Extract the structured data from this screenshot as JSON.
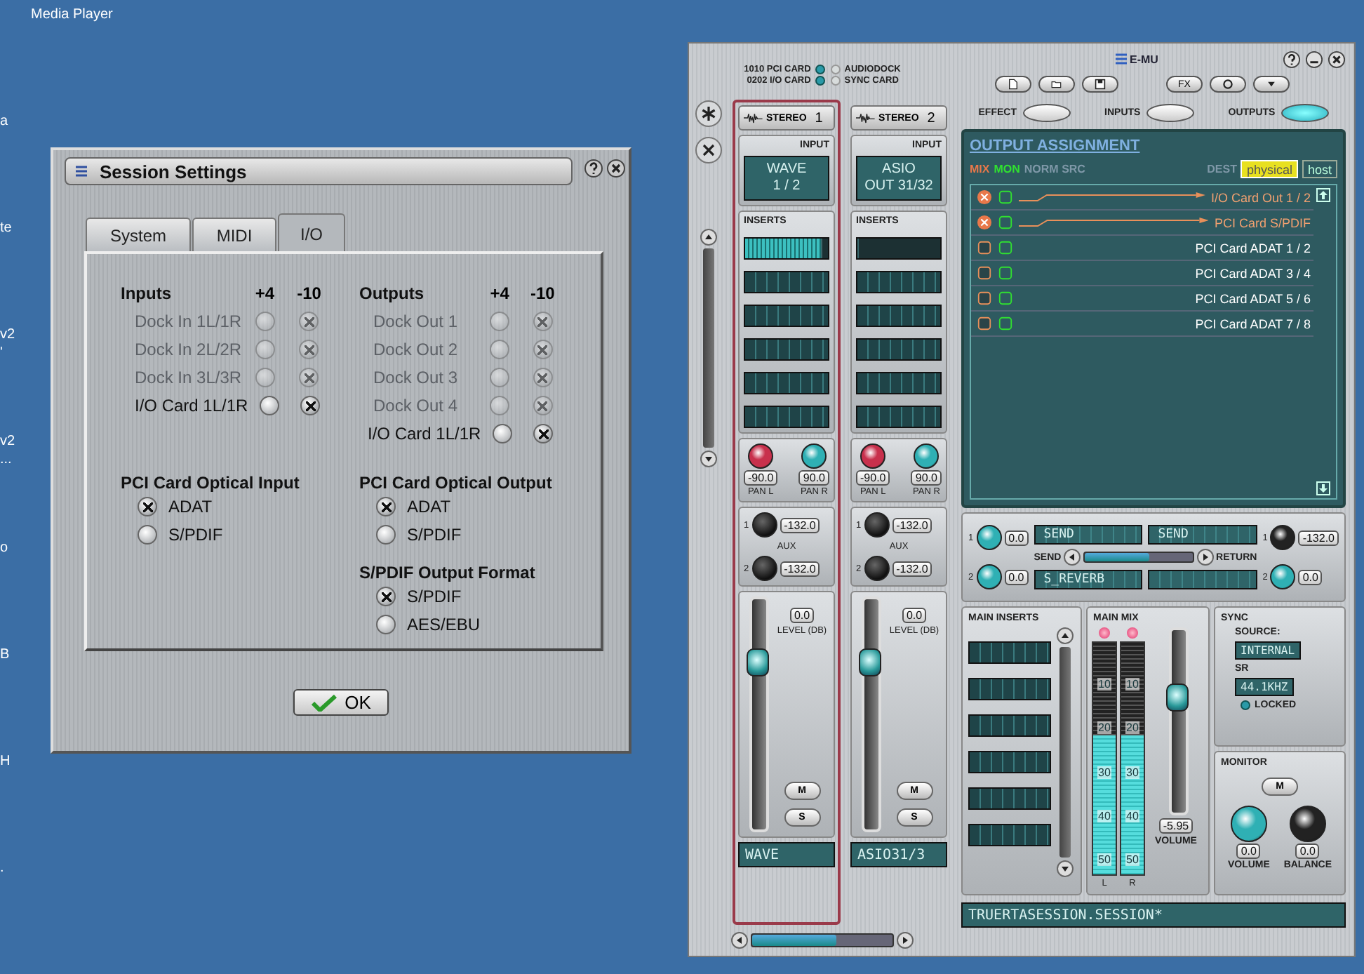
{
  "desktop_icons": [
    {
      "lines": [
        "Media Player"
      ]
    },
    {
      "lines": [
        "a"
      ]
    },
    {
      "lines": [
        "te"
      ]
    },
    {
      "lines": [
        "v2",
        "'"
      ]
    },
    {
      "lines": [
        "v2",
        "..."
      ]
    },
    {
      "lines": [
        "o"
      ]
    },
    {
      "lines": [
        "B"
      ]
    },
    {
      "lines": [
        "H"
      ]
    },
    {
      "lines": [
        "."
      ]
    }
  ],
  "session_dialog": {
    "title": "Session Settings",
    "tabs": [
      {
        "label": "System",
        "selected": false
      },
      {
        "label": "MIDI",
        "selected": false
      },
      {
        "label": "I/O",
        "selected": true
      }
    ],
    "level_sections": [
      {
        "heading": "Inputs",
        "columns": [
          "+4",
          "-10"
        ],
        "rows": [
          {
            "label": "Dock In 1L/1R",
            "disabled": true,
            "radios": [
              {
                "selected": false
              },
              {
                "selected": true
              }
            ]
          },
          {
            "label": "Dock In 2L/2R",
            "disabled": true,
            "radios": [
              {
                "selected": false
              },
              {
                "selected": true
              }
            ]
          },
          {
            "label": "Dock In 3L/3R",
            "disabled": true,
            "radios": [
              {
                "selected": false
              },
              {
                "selected": true
              }
            ]
          },
          {
            "label": "I/O Card 1L/1R",
            "disabled": false,
            "radios": [
              {
                "selected": false
              },
              {
                "selected": true
              }
            ]
          }
        ]
      },
      {
        "heading": "Outputs",
        "columns": [
          "+4",
          "-10"
        ],
        "rows": [
          {
            "label": "Dock Out 1",
            "disabled": true,
            "radios": [
              {
                "selected": false
              },
              {
                "selected": true
              }
            ]
          },
          {
            "label": "Dock Out 2",
            "disabled": true,
            "radios": [
              {
                "selected": false
              },
              {
                "selected": true
              }
            ]
          },
          {
            "label": "Dock Out 3",
            "disabled": true,
            "radios": [
              {
                "selected": false
              },
              {
                "selected": true
              }
            ]
          },
          {
            "label": "Dock Out 4",
            "disabled": true,
            "radios": [
              {
                "selected": false
              },
              {
                "selected": true
              }
            ]
          },
          {
            "label": "I/O Card 1L/1R",
            "disabled": false,
            "radios": [
              {
                "selected": false
              },
              {
                "selected": true
              }
            ]
          }
        ]
      }
    ],
    "option_columns": [
      [
        {
          "heading": "PCI Card Optical Input",
          "options": [
            {
              "label": "ADAT",
              "selected": true
            },
            {
              "label": "S/PDIF",
              "selected": false
            }
          ]
        }
      ],
      [
        {
          "heading": "PCI Card Optical Output",
          "options": [
            {
              "label": "ADAT",
              "selected": true
            },
            {
              "label": "S/PDIF",
              "selected": false
            }
          ]
        },
        {
          "heading": "S/PDIF Output Format",
          "options": [
            {
              "label": "S/PDIF",
              "selected": true
            },
            {
              "label": "AES/EBU",
              "selected": false
            }
          ]
        }
      ]
    ],
    "ok_button": "OK"
  },
  "mixer": {
    "hardware": [
      {
        "label": "1010 PCI CARD",
        "on": true
      },
      {
        "label": "0202 I/O CARD",
        "on": true
      },
      {
        "label": "AUDIODOCK",
        "on": false
      },
      {
        "label": "SYNC CARD",
        "on": false
      }
    ],
    "logo": "E-MU",
    "fx_button": "FX",
    "views": [
      {
        "label": "EFFECT",
        "selected": false
      },
      {
        "label": "INPUTS",
        "selected": false
      },
      {
        "label": "OUTPUTS",
        "selected": true
      }
    ],
    "strips": [
      {
        "name": "STEREO",
        "number": "1",
        "selected": true,
        "input_label": "INPUT",
        "input_lines": [
          "WAVE",
          "1 / 2"
        ],
        "inserts_label": "INSERTS",
        "meter": {
          "level": 0.92
        },
        "pans": [
          {
            "value": "-90.0",
            "label": "PAN L",
            "color": "#c8304c"
          },
          {
            "value": "90.0",
            "label": "PAN R",
            "color": "#2fb0b4"
          }
        ],
        "aux_label": "AUX",
        "aux": [
          {
            "index": "1",
            "value": "-132.0"
          },
          {
            "index": "2",
            "value": "-132.0"
          }
        ],
        "level_value": "0.0",
        "level_label": "LEVEL (DB)",
        "fader": {
          "level": 0.72
        },
        "mute": "M",
        "solo": "S",
        "display": "WAVE"
      },
      {
        "name": "STEREO",
        "number": "2",
        "selected": false,
        "input_label": "INPUT",
        "input_lines": [
          "ASIO",
          "OUT 31/32"
        ],
        "inserts_label": "INSERTS",
        "meter": {
          "level": 0
        },
        "pans": [
          {
            "value": "-90.0",
            "label": "PAN L",
            "color": "#c8304c"
          },
          {
            "value": "90.0",
            "label": "PAN R",
            "color": "#2fb0b4"
          }
        ],
        "aux_label": "AUX",
        "aux": [
          {
            "index": "1",
            "value": "-132.0"
          },
          {
            "index": "2",
            "value": "-132.0"
          }
        ],
        "level_value": "0.0",
        "level_label": "LEVEL (DB)",
        "fader": {
          "level": 0.72
        },
        "mute": "M",
        "solo": "S",
        "display": "ASIO31/3"
      }
    ],
    "output_assignment": {
      "title": "OUTPUT ASSIGNMENT",
      "mix_label": "MIX",
      "mon_label": "MON",
      "norm_label": "NORM SRC",
      "dest_label": "DEST",
      "dest_tabs": [
        {
          "label": "physical",
          "selected": true
        },
        {
          "label": "host",
          "selected": false
        }
      ],
      "rows": [
        {
          "label": "I/O Card Out 1 / 2",
          "mix": true,
          "mon": false
        },
        {
          "label": "PCI Card S/PDIF",
          "mix": true,
          "mon": false
        },
        {
          "label": "PCI Card ADAT 1 / 2",
          "mix": false,
          "mon": false
        },
        {
          "label": "PCI Card ADAT 3 / 4",
          "mix": false,
          "mon": false
        },
        {
          "label": "PCI Card ADAT 5 / 6",
          "mix": false,
          "mon": false
        },
        {
          "label": "PCI Card ADAT 7 / 8",
          "mix": false,
          "mon": false
        }
      ]
    },
    "effects": {
      "send_label": "SEND",
      "sends": [
        {
          "index": "1",
          "value": "0.0",
          "color": "#2fb0b4"
        },
        {
          "index": "2",
          "value": "0.0",
          "color": "#2fb0b4"
        }
      ],
      "slots": [
        "SEND",
        "SEND",
        "S_REVERB"
      ],
      "return_label": "RETURN",
      "returns": [
        {
          "index": "1",
          "value": "-132.0",
          "color": "#222222"
        },
        {
          "index": "2",
          "value": "0.0",
          "color": "#2fb0b4"
        }
      ]
    },
    "main_inserts": {
      "title": "MAIN INSERTS"
    },
    "main_mix": {
      "title": "MAIN MIX",
      "meters": [
        {
          "label": "L",
          "level": 0.6,
          "clip": true,
          "scale": [
            "10",
            "20",
            "30",
            "40",
            "50"
          ]
        },
        {
          "label": "R",
          "level": 0.6,
          "clip": true,
          "scale": [
            "10",
            "20",
            "30",
            "40",
            "50"
          ]
        }
      ],
      "fader": {
        "level": 0.62
      },
      "value": "-5.95",
      "value_label": "VOLUME"
    },
    "sync": {
      "title": "SYNC",
      "source_label": "SOURCE:",
      "source": "INTERNAL",
      "sr_label": "SR",
      "sr": "44.1KHZ",
      "locked_label": "LOCKED",
      "locked": true
    },
    "monitor": {
      "title": "MONITOR",
      "mute": "M",
      "knobs": [
        {
          "value": "0.0",
          "label": "VOLUME",
          "color": "#2fb0b4"
        },
        {
          "value": "0.0",
          "label": "BALANCE",
          "color": "#222222"
        }
      ]
    },
    "status": "TRUERTASESSION.SESSION*"
  }
}
